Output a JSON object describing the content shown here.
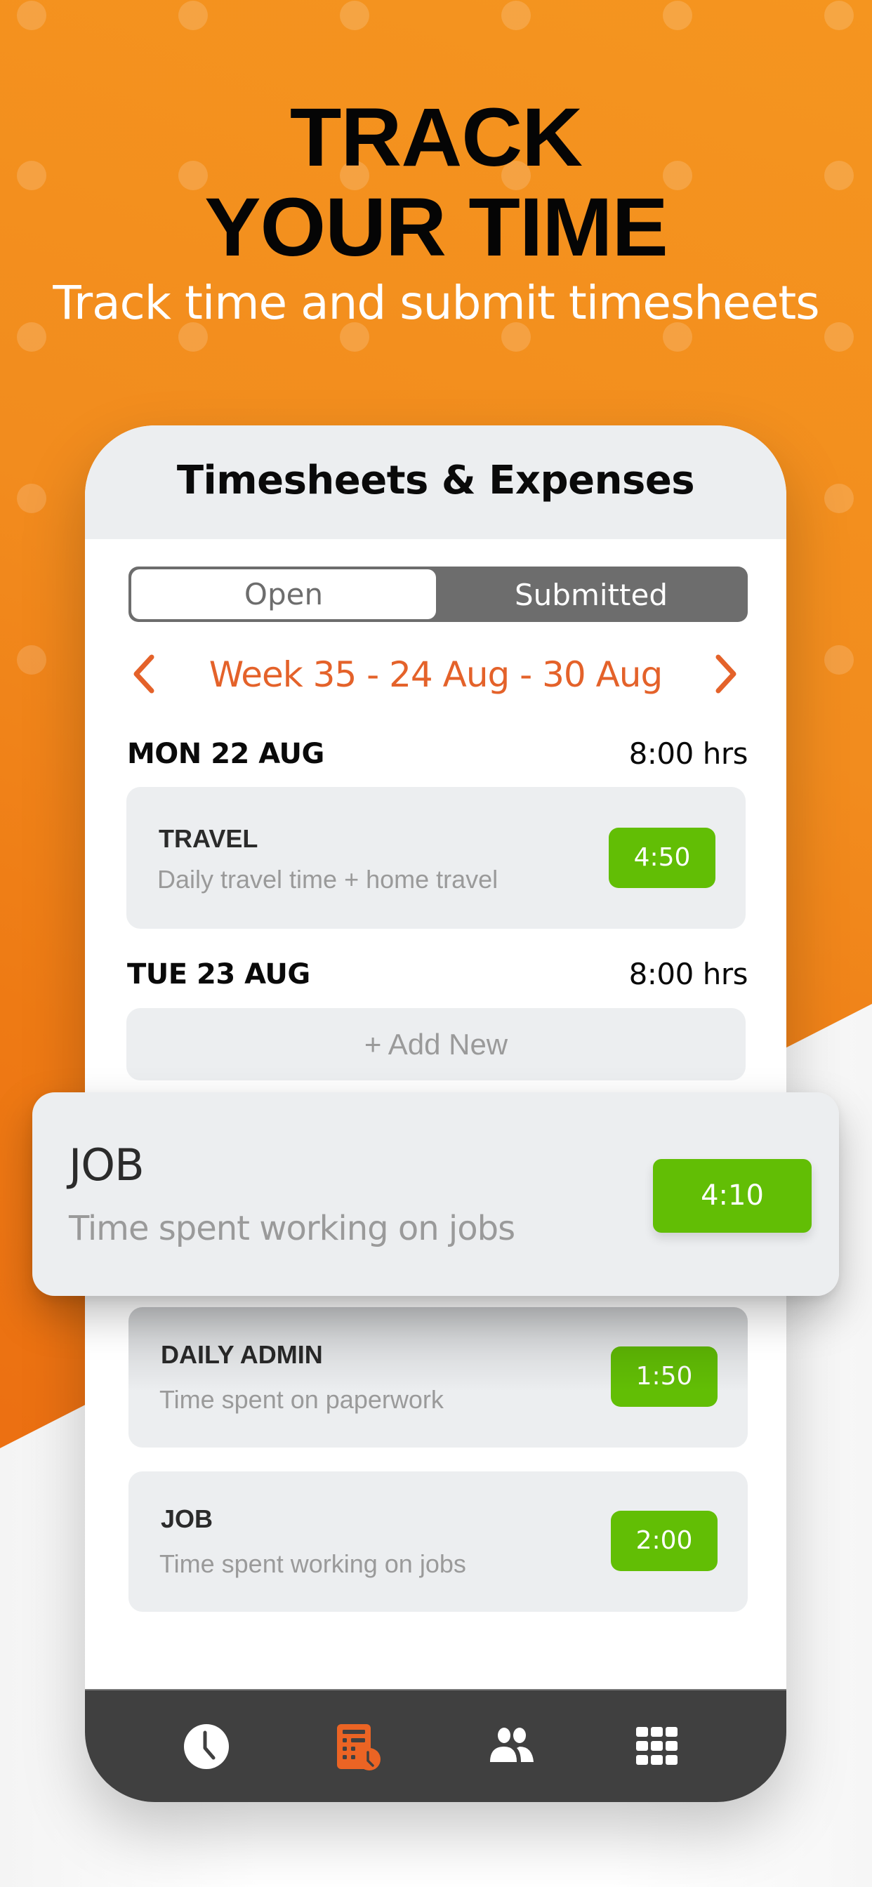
{
  "hero": {
    "title_line1": "TRACK",
    "title_line2": "YOUR TIME",
    "subtitle": "Track time and submit timesheets"
  },
  "app": {
    "title": "Timesheets & Expenses",
    "tabs": [
      {
        "label": "Open",
        "selected": true
      },
      {
        "label": "Submitted",
        "selected": false
      }
    ],
    "week": {
      "label": "Week 35 - 24 Aug - 30 Aug",
      "prev_icon": "chevron-left-icon",
      "next_icon": "chevron-right-icon"
    },
    "days": [
      {
        "name": "MON 22 AUG",
        "hours": "8:00 hrs",
        "entries": [
          {
            "title": "TRAVEL",
            "description": "Daily travel time + home travel",
            "duration": "4:50"
          }
        ]
      },
      {
        "name": "TUE 23 AUG",
        "hours": "8:00 hrs",
        "add_new_label": "+ Add New",
        "entries": [
          {
            "title": "JOB",
            "description": "Time spent working on jobs",
            "duration": "4:10"
          },
          {
            "title": "DAILY ADMIN",
            "description": "Time spent on paperwork",
            "duration": "1:50"
          },
          {
            "title": "JOB",
            "description": "Time spent working on jobs",
            "duration": "2:00"
          }
        ]
      }
    ],
    "nav": [
      {
        "icon": "clock-icon",
        "active": false
      },
      {
        "icon": "timesheet-calculator-icon",
        "active": true
      },
      {
        "icon": "people-icon",
        "active": false
      },
      {
        "icon": "grid-menu-icon",
        "active": false
      }
    ]
  },
  "colors": {
    "brand_orange": "#f39222",
    "accent_orange": "#e4622a",
    "badge_green": "#62be05",
    "navbar_dark": "#404040",
    "segment_gray": "#6d6d6d"
  }
}
